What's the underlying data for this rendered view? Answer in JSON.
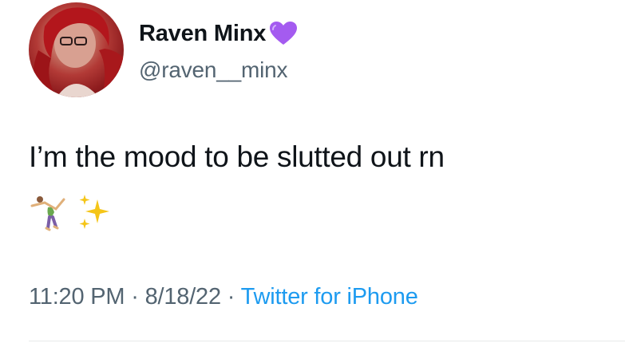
{
  "author": {
    "display_name": "Raven Minx",
    "handle": "@raven__minx",
    "name_emoji_icon": "purple-heart-icon",
    "avatar_icon": "profile-avatar"
  },
  "tweet": {
    "text": "I’m the mood to be slutted out rn",
    "emojis": [
      "person-cartwheeling-icon",
      "sparkles-icon"
    ]
  },
  "meta": {
    "time": "11:20 PM",
    "separator": " · ",
    "date": "8/18/22",
    "source": "Twitter for iPhone"
  },
  "colors": {
    "text_primary": "#0f1419",
    "text_secondary": "#536471",
    "link": "#1d9bf0",
    "heart": "#a45bf0",
    "divider": "#e7e9ea"
  }
}
